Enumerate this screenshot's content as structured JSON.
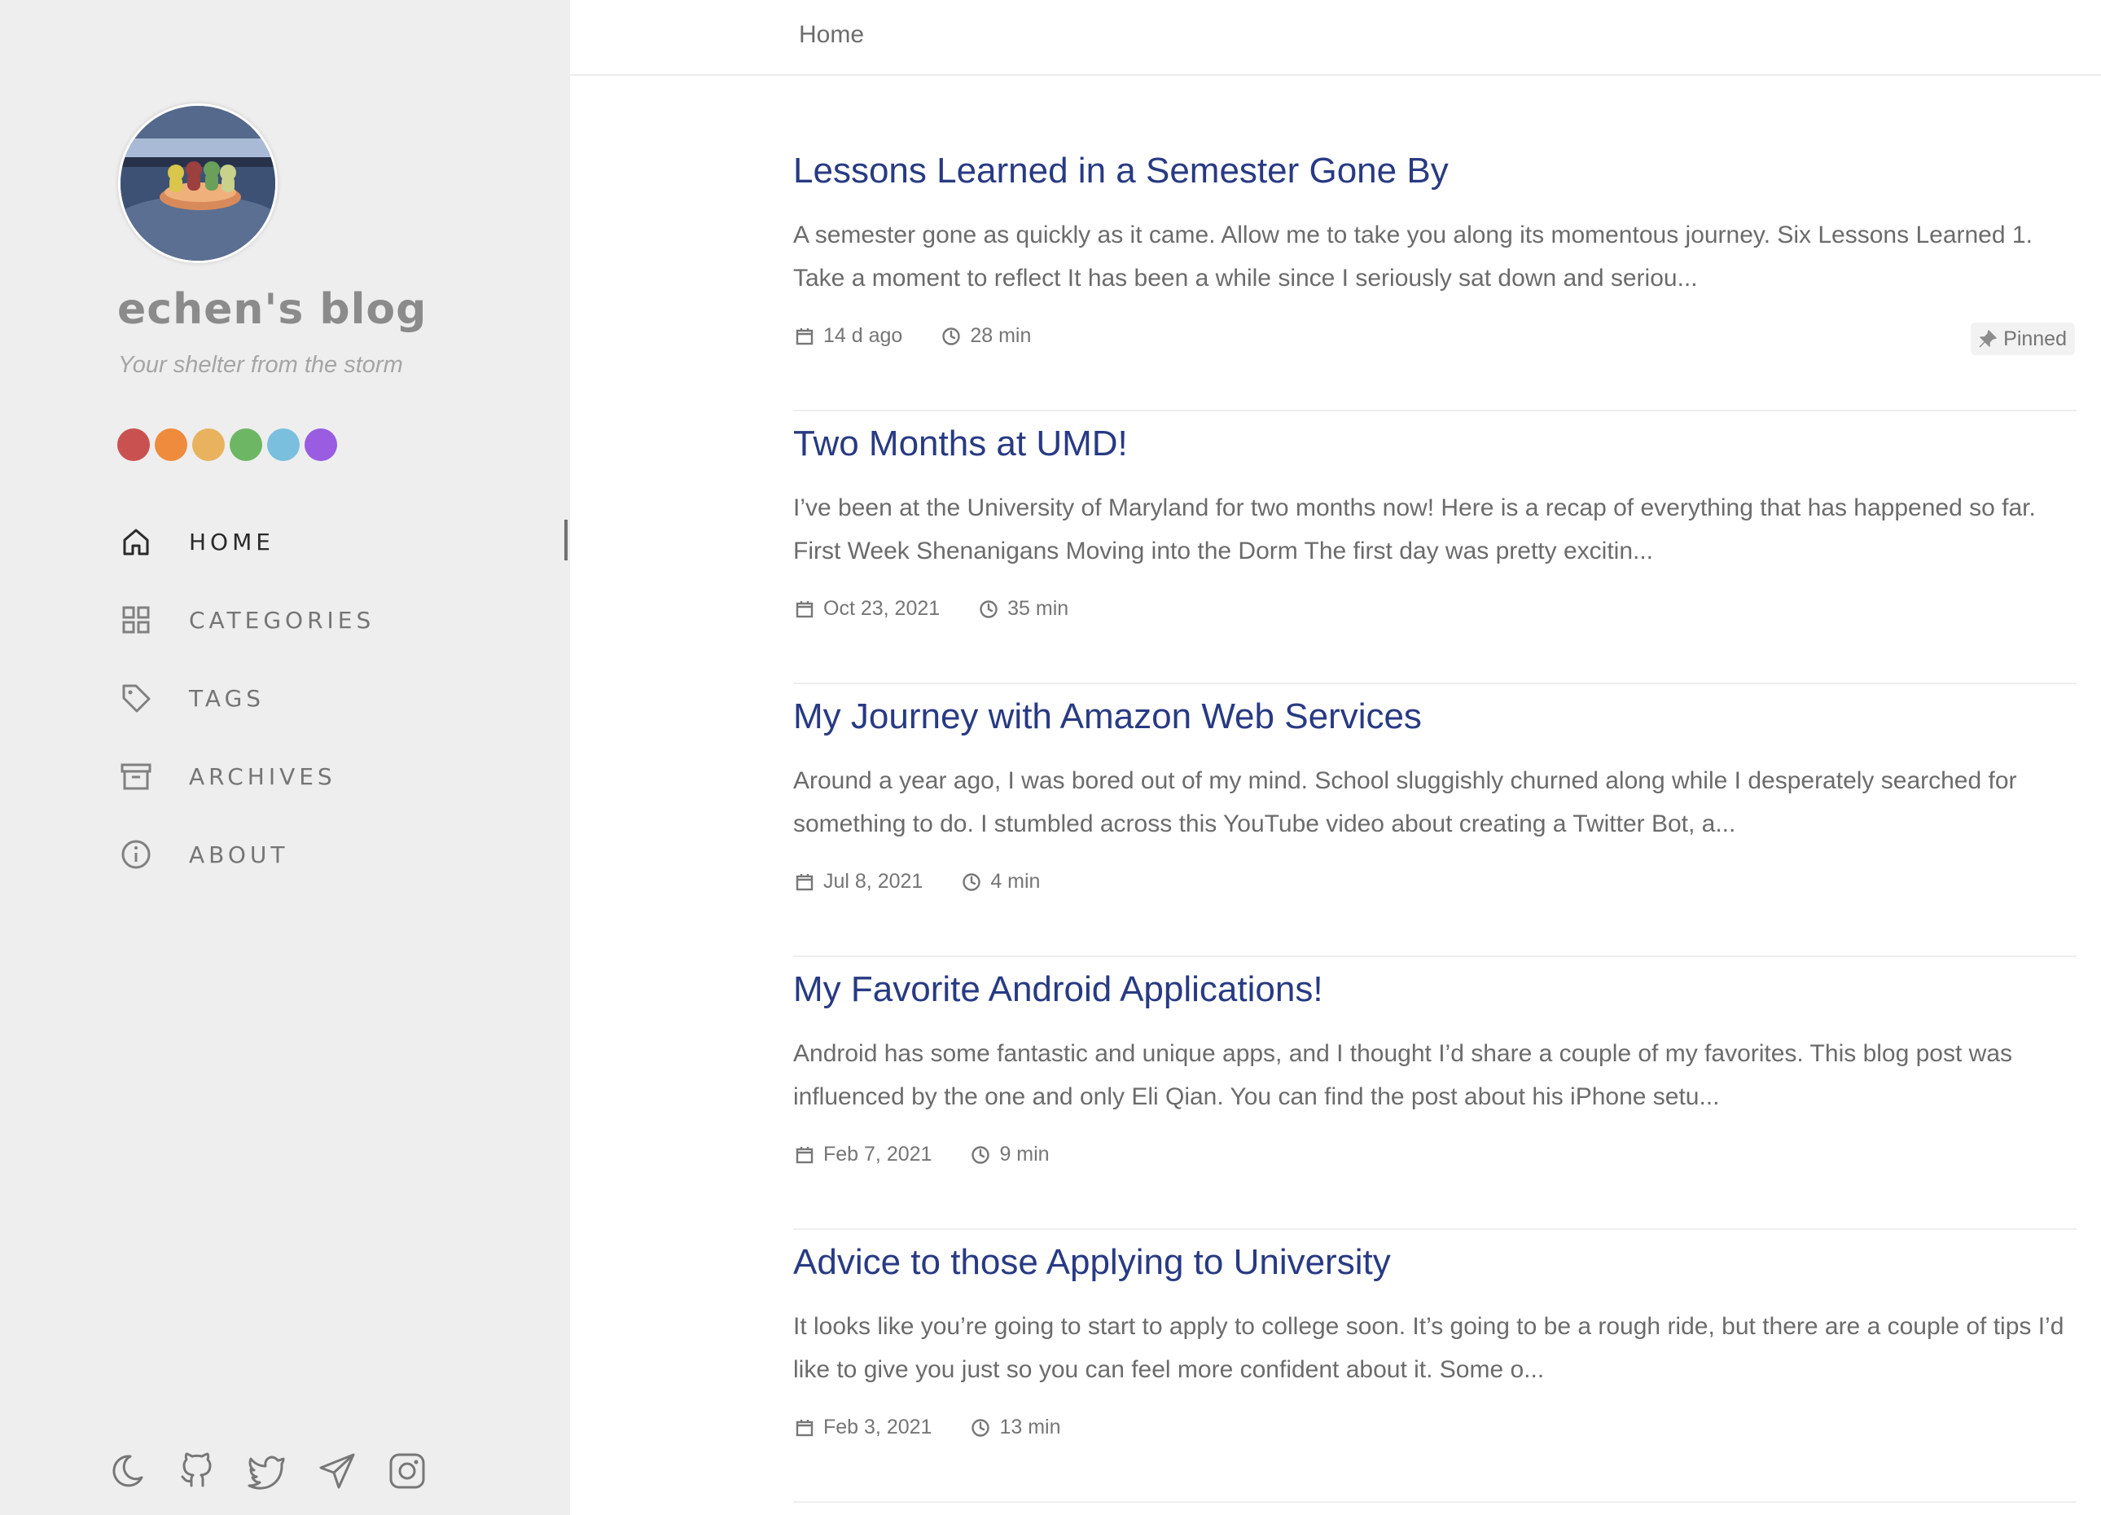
{
  "sidebar": {
    "title": "echen's blog",
    "subtitle": "Your shelter from the storm",
    "avatar_icon": "gummy-bear-avatar",
    "color_dots": [
      "#c9514f",
      "#ef8b3c",
      "#e8b25e",
      "#6db764",
      "#7abfde",
      "#9a5ce0"
    ],
    "nav": [
      {
        "label": "HOME",
        "icon": "home-icon",
        "active": true
      },
      {
        "label": "CATEGORIES",
        "icon": "grid-icon",
        "active": false
      },
      {
        "label": "TAGS",
        "icon": "tag-icon",
        "active": false
      },
      {
        "label": "ARCHIVES",
        "icon": "archive-icon",
        "active": false
      },
      {
        "label": "ABOUT",
        "icon": "info-icon",
        "active": false
      }
    ],
    "bottom_icons": [
      "moon-icon",
      "github-icon",
      "twitter-icon",
      "telegram-icon",
      "instagram-icon"
    ]
  },
  "topbar": {
    "breadcrumb": "Home"
  },
  "posts": [
    {
      "title": "Lessons Learned in a Semester Gone By",
      "excerpt": "A semester gone as quickly as it came. Allow me to take you along its momentous journey. Six Lessons Learned 1. Take a moment to reflect It has been a while since I seriously sat down and seriou...",
      "date": "14 d ago",
      "read_time": "28 min",
      "pinned": "Pinned"
    },
    {
      "title": "Two Months at UMD!",
      "excerpt": "I’ve been at the University of Maryland for two months now! Here is a recap of everything that has happened so far. First Week Shenanigans Moving into the Dorm The first day was pretty excitin...",
      "date": "Oct 23, 2021",
      "read_time": "35 min"
    },
    {
      "title": "My Journey with Amazon Web Services",
      "excerpt": "Around a year ago, I was bored out of my mind. School sluggishly churned along while I desperately searched for something to do. I stumbled across this YouTube video about creating a Twitter Bot, a...",
      "date": "Jul 8, 2021",
      "read_time": "4 min"
    },
    {
      "title": "My Favorite Android Applications!",
      "excerpt": "Android has some fantastic and unique apps, and I thought I’d share a couple of my favorites. This blog post was influenced by the one and only Eli Qian. You can find the post about his iPhone setu...",
      "date": "Feb 7, 2021",
      "read_time": "9 min"
    },
    {
      "title": "Advice to those Applying to University",
      "excerpt": "It looks like you’re going to start to apply to college soon. It’s going to be a rough ride, but there are a couple of tips I’d like to give you just so you can feel more confident about it. Some o...",
      "date": "Feb 3, 2021",
      "read_time": "13 min"
    }
  ],
  "colors": {
    "sidebar_bg": "#eeeeee",
    "title_link": "#283a83",
    "text": "#6b6b6b"
  }
}
